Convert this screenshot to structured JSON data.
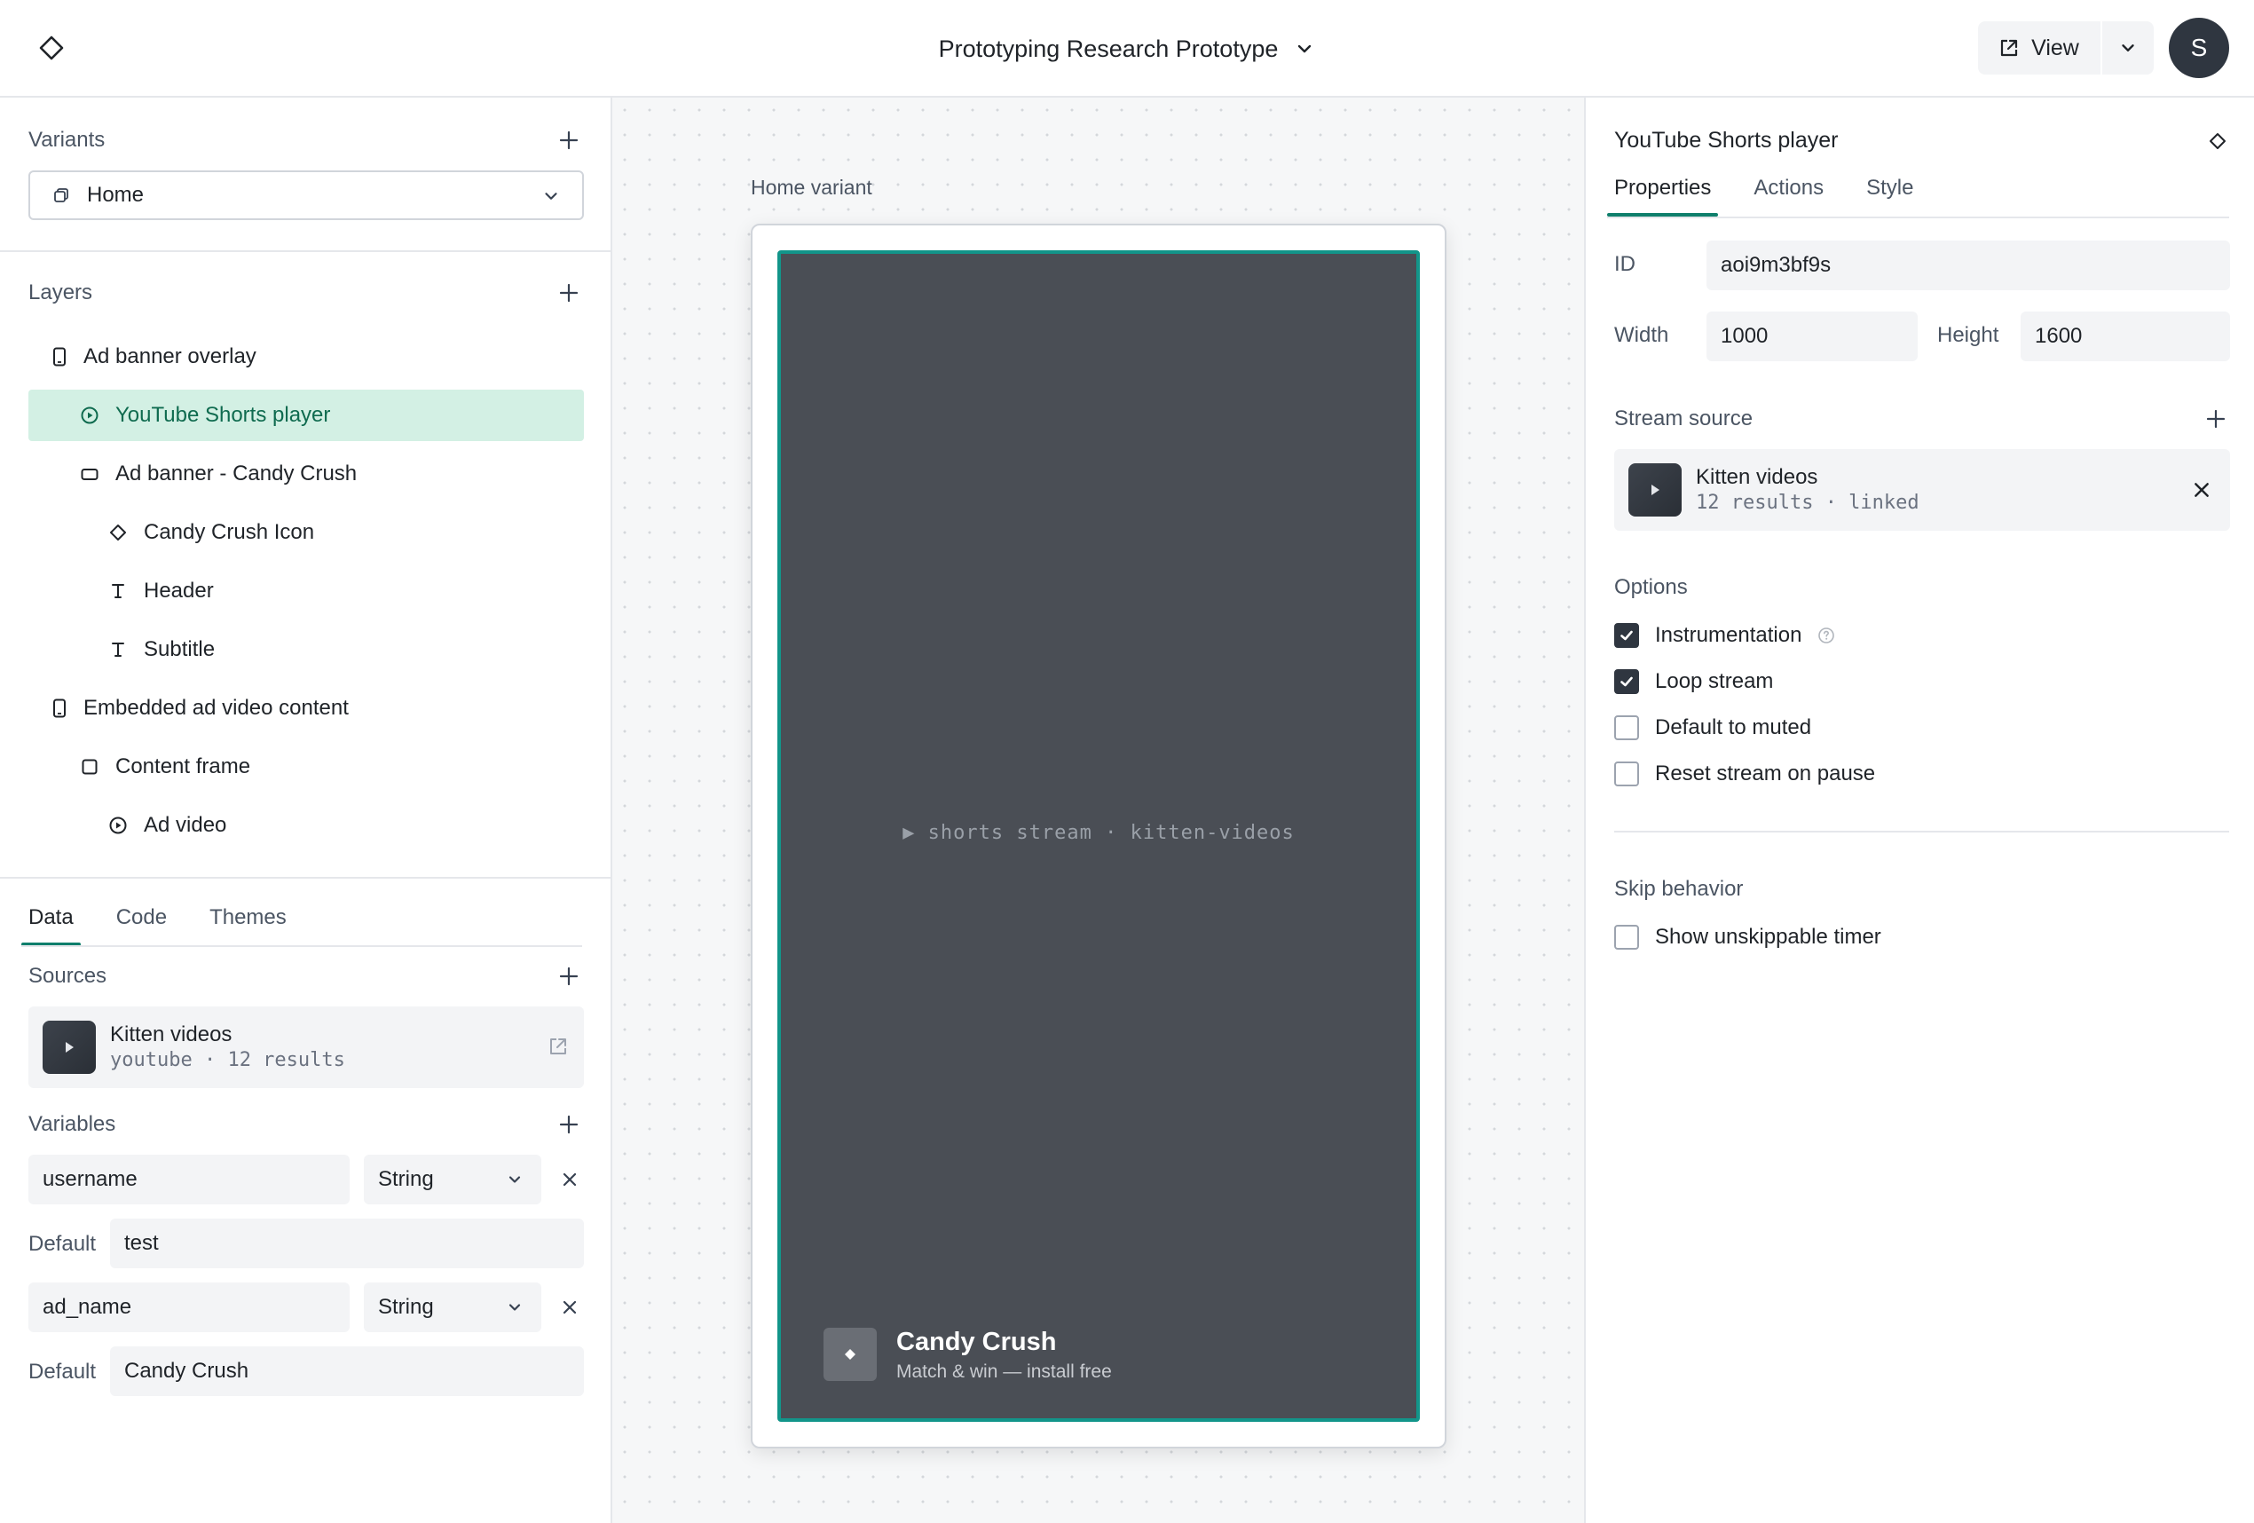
{
  "topbar": {
    "title": "Prototyping Research Prototype",
    "view_label": "View",
    "avatar_initial": "S"
  },
  "left": {
    "variants_header": "Variants",
    "variant_selected": "Home",
    "layers_header": "Layers",
    "layers": [
      {
        "label": "Ad banner overlay",
        "icon": "mobile-icon"
      },
      {
        "label": "YouTube Shorts player",
        "icon": "play-circle-icon",
        "selected": true
      },
      {
        "label": "Ad banner - Candy Crush",
        "icon": "rectangle-icon"
      },
      {
        "label": "Candy Crush Icon",
        "icon": "diamond-icon"
      },
      {
        "label": "Header",
        "icon": "text-icon"
      },
      {
        "label": "Subtitle",
        "icon": "text-icon"
      },
      {
        "label": "Embedded ad video content",
        "icon": "mobile-icon"
      },
      {
        "label": "Content frame",
        "icon": "square-icon"
      },
      {
        "label": "Ad video",
        "icon": "play-circle-icon"
      }
    ],
    "tabs": [
      "Data",
      "Code",
      "Themes"
    ],
    "active_tab": "Data",
    "sources_header": "Sources",
    "source": {
      "title": "Kitten videos",
      "subtitle": "youtube · 12 results"
    },
    "variables_header": "Variables",
    "variables": [
      {
        "name": "username",
        "type": "String",
        "default_label": "Default",
        "default": "test"
      },
      {
        "name": "ad_name",
        "type": "String",
        "default_label": "Default",
        "default": "Candy Crush"
      }
    ]
  },
  "canvas": {
    "variant_label": "Home variant",
    "stream_caption": "▶ shorts stream · kitten-videos",
    "ad_title": "Candy Crush",
    "ad_subtitle": "Match & win — install free"
  },
  "inspector": {
    "title": "YouTube Shorts player",
    "tabs": [
      "Properties",
      "Actions",
      "Style"
    ],
    "active_tab": "Properties",
    "id_label": "ID",
    "id_value": "aoi9m3bf9s",
    "width_label": "Width",
    "width_value": "1000",
    "height_label": "Height",
    "height_value": "1600",
    "stream_source_header": "Stream source",
    "stream_source": {
      "title": "Kitten videos",
      "subtitle": "12 results · linked"
    },
    "options_header": "Options",
    "options": [
      {
        "label": "Instrumentation",
        "checked": true,
        "help": true
      },
      {
        "label": "Loop stream",
        "checked": true
      },
      {
        "label": "Default to muted",
        "checked": false
      },
      {
        "label": "Reset stream on pause",
        "checked": false
      }
    ],
    "skip_header": "Skip behavior",
    "skip_options": [
      {
        "label": "Show unskippable timer",
        "checked": false
      }
    ]
  },
  "colors": {
    "accent": "#12958a",
    "selected_bg": "#d3f0e4",
    "player_bg": "#4a4e55"
  }
}
